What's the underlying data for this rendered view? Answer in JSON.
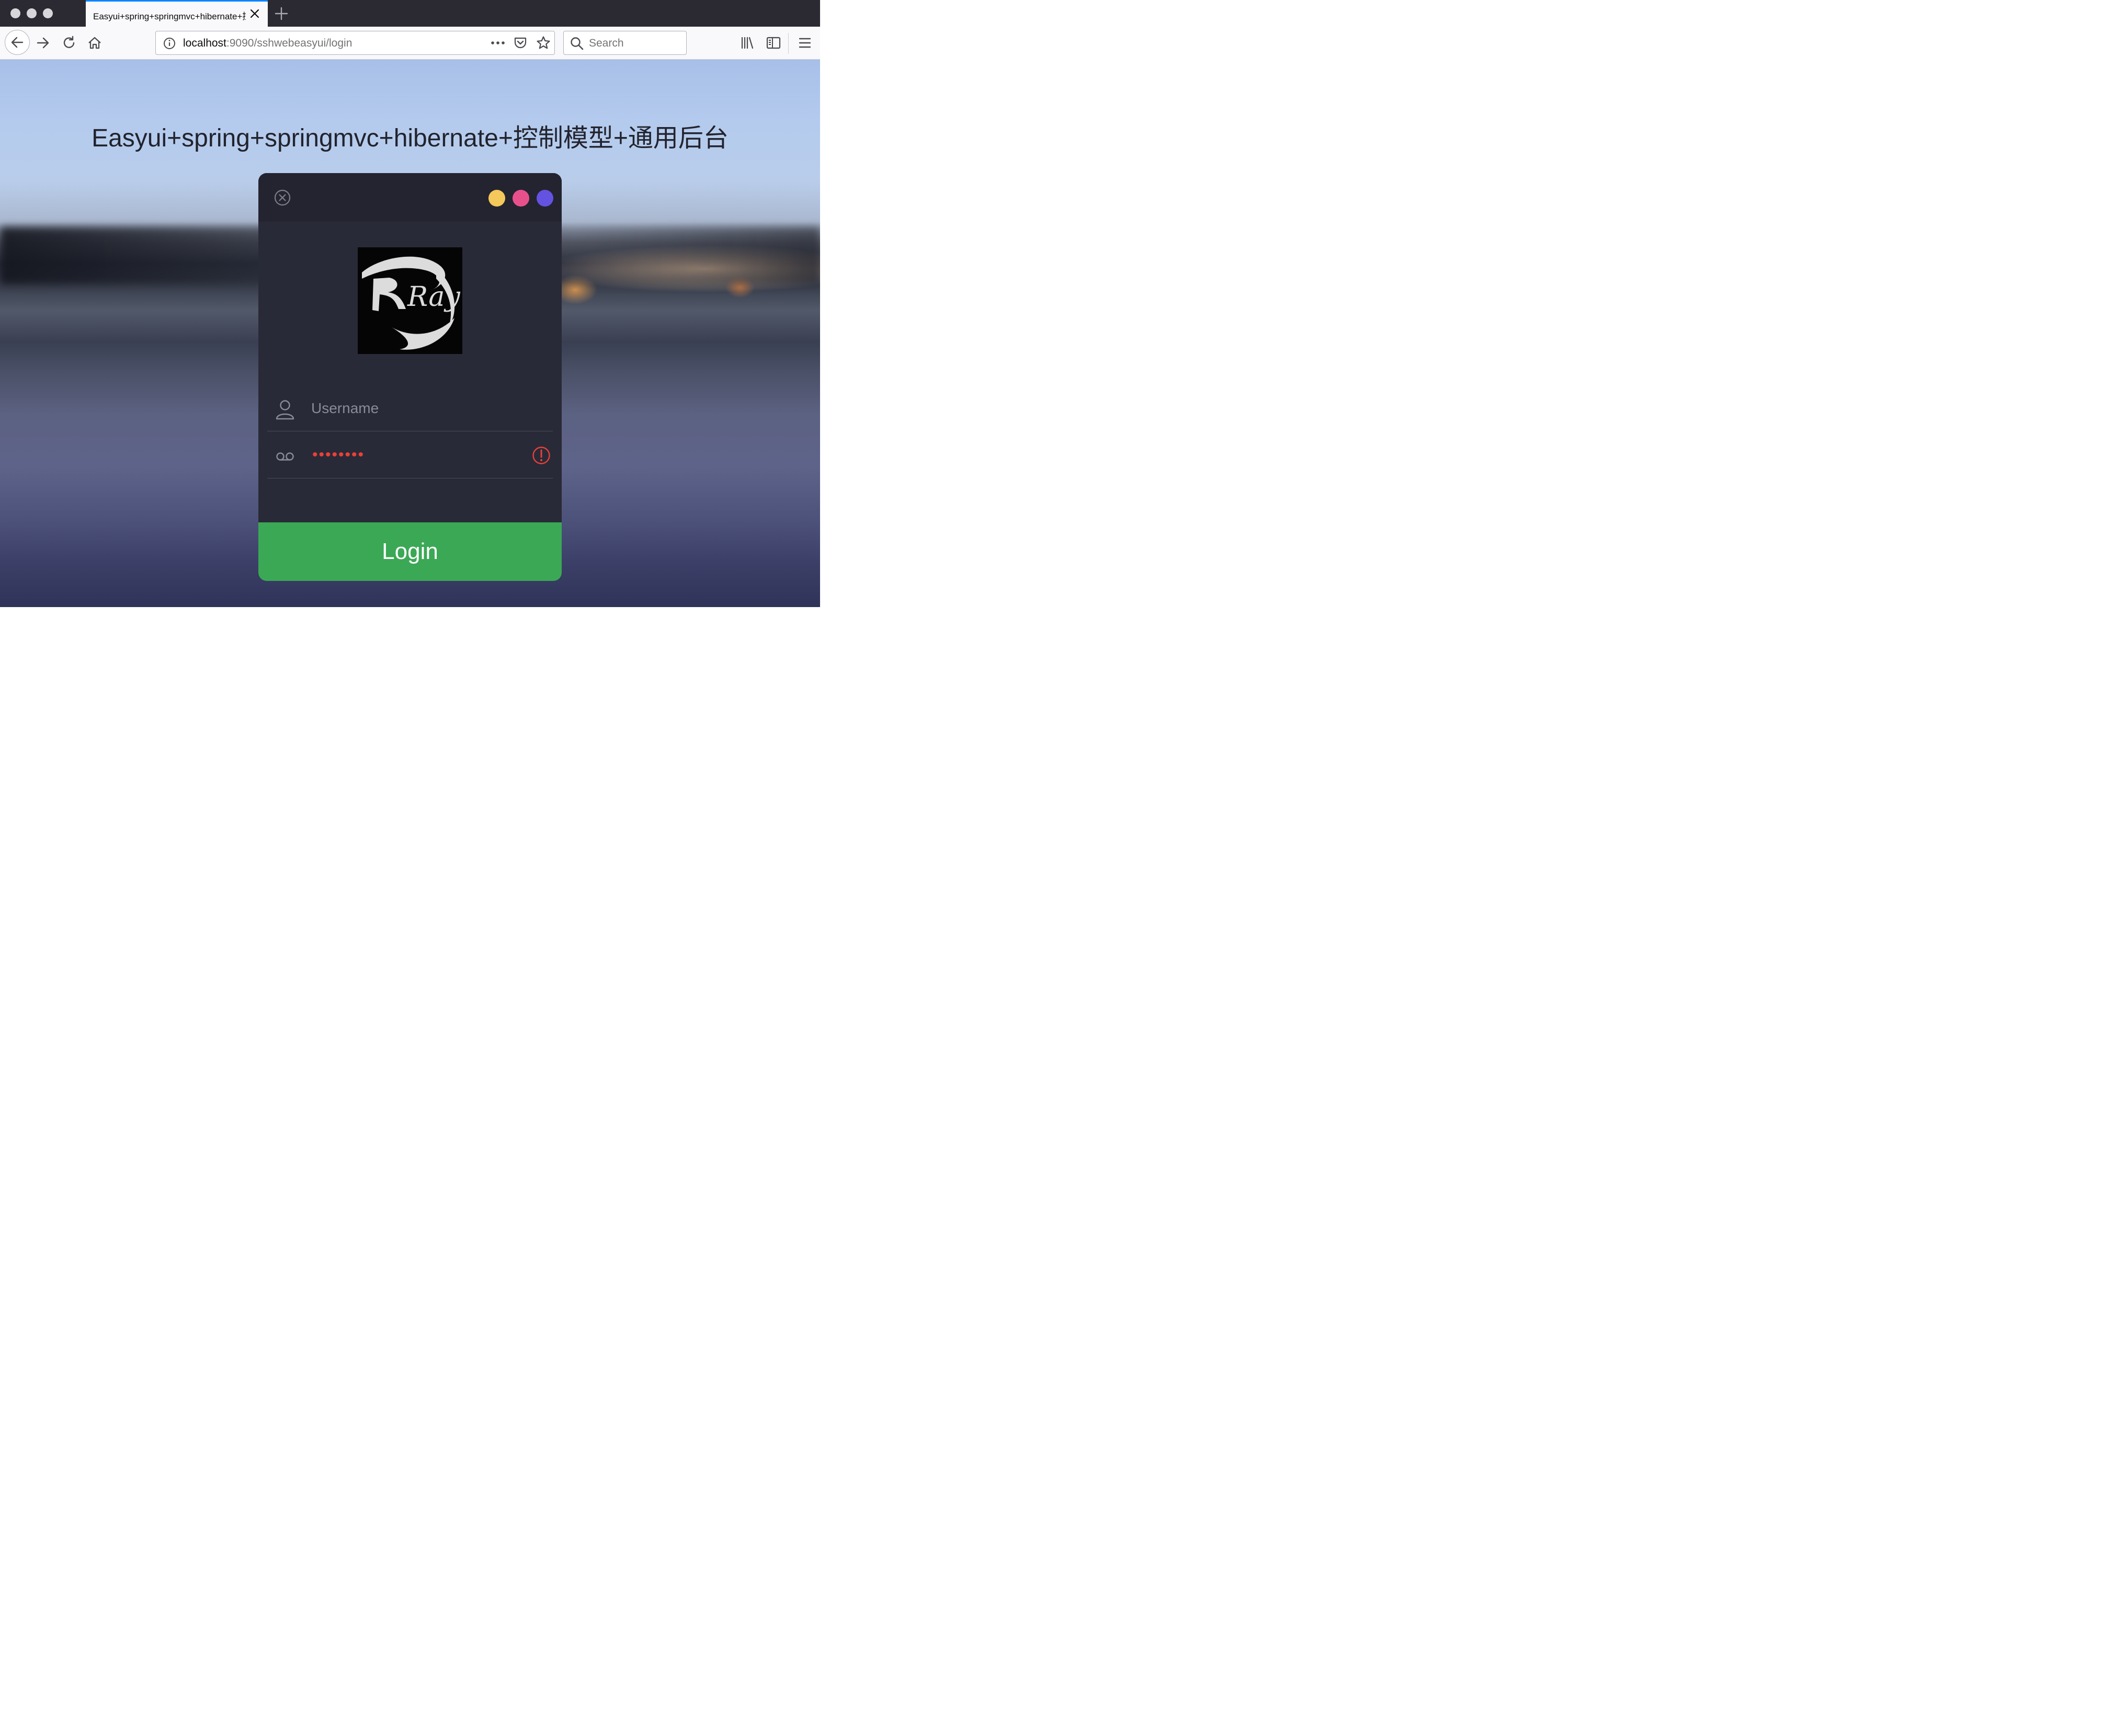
{
  "browser": {
    "tab": {
      "title": "Easyui+spring+springmvc+hibernate+控制模型+通用后台"
    },
    "url": {
      "host": "localhost",
      "path": ":9090/sshwebeasyui/login"
    },
    "search": {
      "placeholder": "Search"
    },
    "icons": [
      "back-icon",
      "forward-icon",
      "reload-icon",
      "home-icon",
      "info-icon",
      "more-icon",
      "pocket-icon",
      "bookmark-star-icon",
      "search-icon",
      "library-icon",
      "sidebar-icon",
      "menu-icon"
    ]
  },
  "page": {
    "title": "Easyui+spring+springmvc+hibernate+控制模型+通用后台"
  },
  "login": {
    "theme_colors": [
      "#f4c85a",
      "#e8508c",
      "#6452e0"
    ],
    "logo_text": "Ray",
    "username": {
      "placeholder": "Username",
      "value": ""
    },
    "password": {
      "masked": "••••••••",
      "state": "error"
    },
    "button_label": "Login",
    "colors": {
      "button": "#3ba856",
      "panel": "#292a37",
      "error": "#e8403a"
    }
  }
}
